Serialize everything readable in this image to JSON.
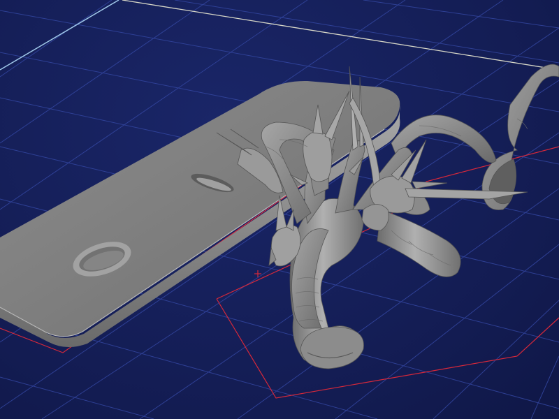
{
  "viewport": {
    "background_color": "#16205a",
    "grid_color": "#3a4aa0",
    "build_edge_color": "#9fc7e8",
    "build_edge_far_color": "#d8d8c8",
    "footprint_color": "#d8283a",
    "model_color": "#8e8e8e",
    "model_highlight_color": "#b4b4b4",
    "model_shadow_color": "#5a5a5a"
  },
  "scene": {
    "objects": [
      {
        "name": "base-plate",
        "kind": "slab",
        "holes": 2
      },
      {
        "name": "hydra-sculpture",
        "kind": "model",
        "heads": 6
      }
    ],
    "origin_marker_icon": "cross-marker-icon"
  }
}
